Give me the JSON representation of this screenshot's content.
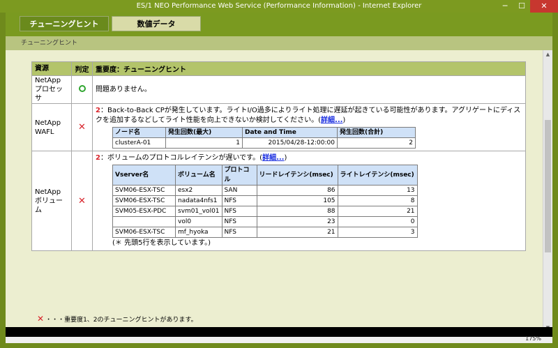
{
  "window": {
    "title": "ES/1 NEO Performance Web Service (Performance Information) - Internet Explorer",
    "min": "─",
    "max": "☐",
    "close": "✕"
  },
  "tabs": [
    {
      "label": "チューニングヒント"
    },
    {
      "label": "数値データ"
    }
  ],
  "breadcrumb": "チューニングヒント",
  "table": {
    "headers": [
      "資源",
      "判定",
      "重要度：チューニングヒント"
    ],
    "rows": [
      {
        "resource": "NetApp プロセッサ",
        "message": "問題ありません。"
      },
      {
        "resource": "NetApp WAFL",
        "num": "2",
        "message": "：Back-to-Back CPが発生しています。ライトI/O過多によりライト処理に遅延が起きている可能性があります。アグリゲートにディスクを追加するなどしてライト性能を向上できないか検討してください。(",
        "link": "詳細...",
        "message_end": ")",
        "sub_headers": [
          "ノード名",
          "発生回数(最大)",
          "Date and Time",
          "発生回数(合計)"
        ],
        "sub_rows": [
          [
            "clusterA-01",
            "1",
            "2015/04/28-12:00:00",
            "2"
          ]
        ]
      },
      {
        "resource": "NetApp ボリューム",
        "num": "2",
        "message": "：ボリュームのプロトコルレイテンシが遅いです。(",
        "link": "詳細...",
        "message_end": ")",
        "sub_headers": [
          "Vserver名",
          "ボリューム名",
          "プロトコル",
          "リードレイテンシ(msec)",
          "ライトレイテンシ(msec)"
        ],
        "sub_rows": [
          [
            "SVM06-ESX-TSC",
            "esx2",
            "SAN",
            "86",
            "13"
          ],
          [
            "SVM06-ESX-TSC",
            "nadata4nfs1",
            "NFS",
            "105",
            "8"
          ],
          [
            "SVM05-ESX-PDC",
            "svm01_vol01",
            "NFS",
            "88",
            "21"
          ],
          [
            "",
            "vol0",
            "NFS",
            "23",
            "0"
          ],
          [
            "SVM06-ESX-TSC",
            "mf_hyoka",
            "NFS",
            "21",
            "3"
          ]
        ],
        "note": "(＊ 先頭5行を表示しています。)"
      }
    ]
  },
  "legend": {
    "x_text": "・・・重要度1、2のチューニングヒントがあります。"
  },
  "status": {
    "zoom": "175%"
  },
  "icons": {
    "ok": "ok-circle-icon",
    "ng": "error-x-icon"
  },
  "colors": {
    "accent": "#7a9a20",
    "error": "#d8232a",
    "ok": "#2fa52f",
    "link": "#1a2ee0"
  }
}
